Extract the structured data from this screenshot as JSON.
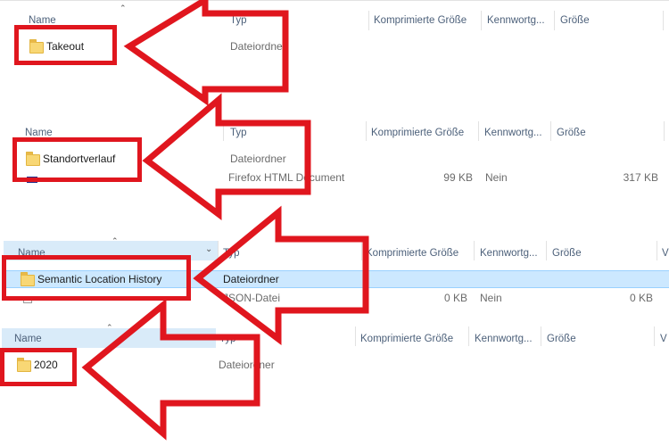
{
  "columns": {
    "name": "Name",
    "type": "Typ",
    "compressed": "Komprimierte Größe",
    "password": "Kennwortg...",
    "size": "Größe",
    "ratio": "V"
  },
  "panel1": {
    "folder": "Takeout",
    "folder_type": "Dateiordner"
  },
  "panel2": {
    "folder": "Standortverlauf",
    "folder_type": "Dateiordner",
    "file_type": "Firefox HTML Document",
    "file_compressed": "99 KB",
    "file_password": "Nein",
    "file_size": "317 KB"
  },
  "panel3": {
    "folder": "Semantic Location History",
    "folder_type": "Dateiordner",
    "file_type": "JSON-Datei",
    "file_compressed": "0 KB",
    "file_password": "Nein",
    "file_size": "0 KB"
  },
  "panel4": {
    "folder": "2020",
    "folder_type": "Dateiordner"
  },
  "colors": {
    "highlight_arrow": "#e0161e",
    "selection": "#cce8ff",
    "folder": "#f8d775"
  }
}
